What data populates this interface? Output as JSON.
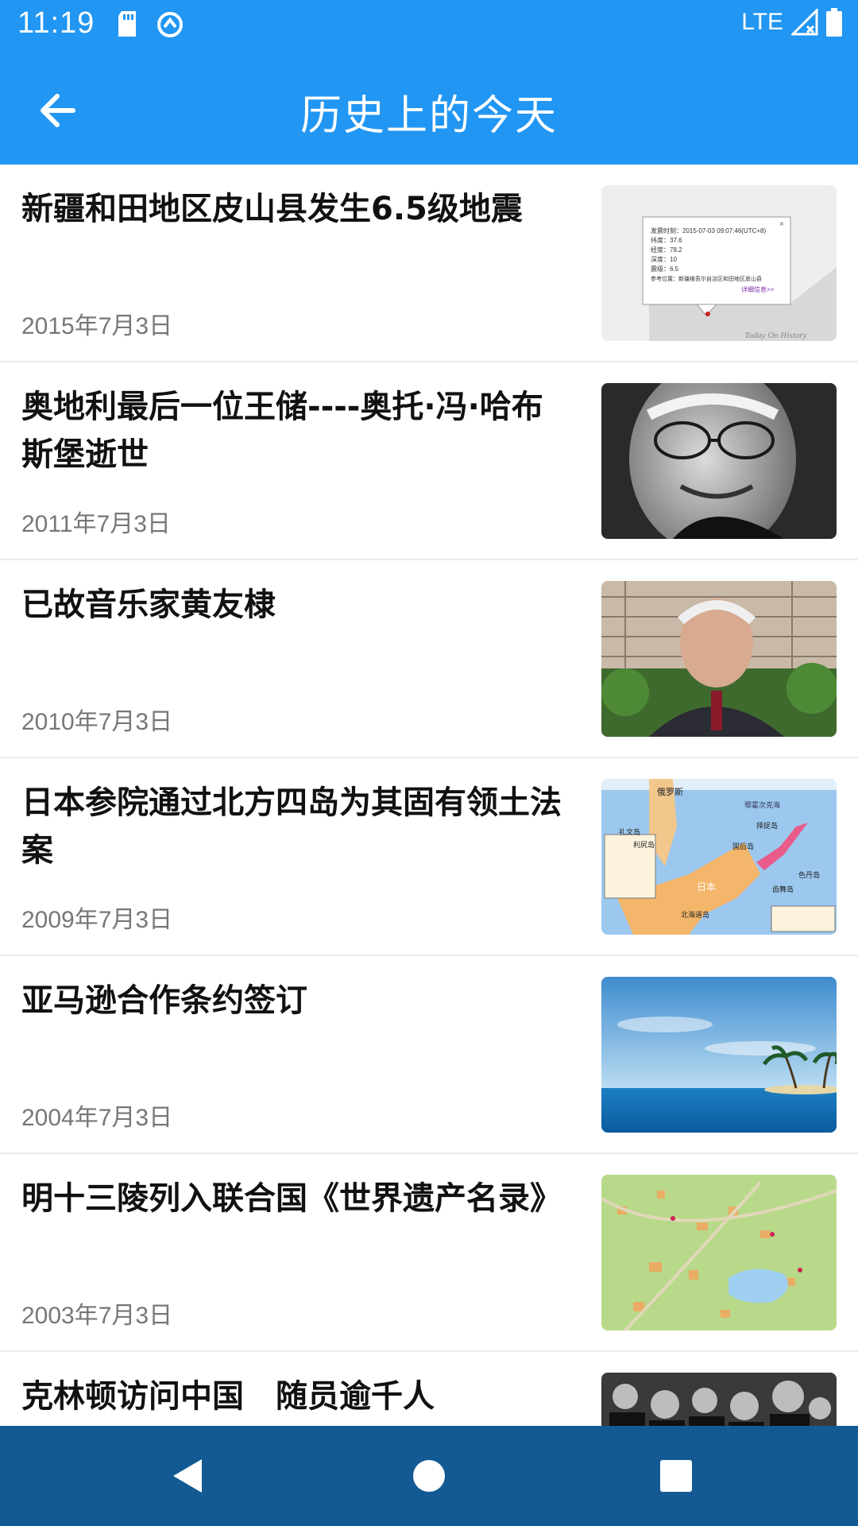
{
  "status_bar": {
    "time": "11:19",
    "network": "LTE",
    "icons": [
      "sd-card-icon",
      "data-saver-icon",
      "signal-icon",
      "battery-icon"
    ]
  },
  "app_bar": {
    "title": "历史上的今天",
    "back_icon": "arrow-back-icon"
  },
  "events": [
    {
      "title": "新疆和田地区皮山县发生6.5级地震",
      "date": "2015年7月3日",
      "image": "earthquake-map-popup"
    },
    {
      "title": "奥地利最后一位王储----奥托·冯·哈布斯堡逝世",
      "date": "2011年7月3日",
      "image": "portrait-elderly-man-glasses"
    },
    {
      "title": "已故音乐家黄友棣",
      "date": "2010年7月3日",
      "image": "portrait-elderly-man-suit"
    },
    {
      "title": "日本参院通过北方四岛为其固有领土法案",
      "date": "2009年7月3日",
      "image": "map-northern-islands"
    },
    {
      "title": "亚马逊合作条约签订",
      "date": "2004年7月3日",
      "image": "sea-island-palm-trees"
    },
    {
      "title": "明十三陵列入联合国《世界遗产名录》",
      "date": "2003年7月3日",
      "image": "map-ming-tombs"
    },
    {
      "title": "克林顿访问中国　随员逾千人",
      "date": "",
      "image": "photo-crowd"
    }
  ],
  "thumb_text": {
    "earthquake_watermark": "Today On History",
    "earthquake_popup_lines": [
      "发震时刻：2015-07-03 09:07:46(UTC+8)",
      "纬度：37.6",
      "经度：78.2",
      "深度：10",
      "震级：6.5",
      "参考位置：新疆维吾尔自治区和田地区皮山县"
    ],
    "earthquake_popup_link": "详细信息>>",
    "map_labels": [
      "择捉岛",
      "国后岛",
      "色丹岛",
      "齿舞岛",
      "礼文岛",
      "利尻岛",
      "北海道岛",
      "日本",
      "俄罗斯",
      "鄂霍次克海"
    ]
  },
  "nav_bar": {
    "back_icon": "nav-back-triangle-icon",
    "home_icon": "nav-home-circle-icon",
    "recents_icon": "nav-recents-square-icon"
  },
  "colors": {
    "primary": "#2196F3",
    "nav_bar": "#135A94",
    "title_text": "#111111",
    "date_text": "#777777",
    "divider": "#ececec"
  }
}
